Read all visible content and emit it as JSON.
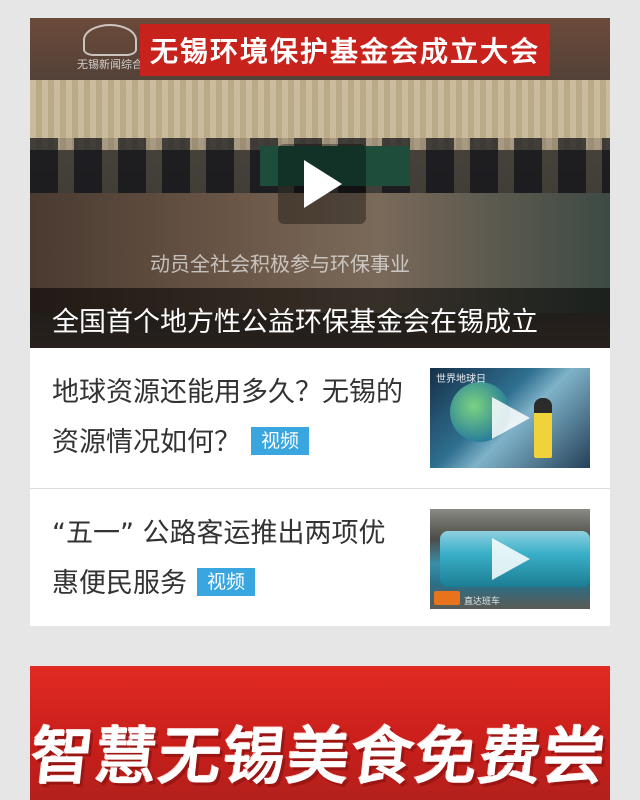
{
  "hero": {
    "banner_text": "无锡环境保护基金会成立大会",
    "logo_text": "无锡新闻综合",
    "subline": "动员全社会积极参与环保事业",
    "caption": "全国首个地方性公益环保基金会在锡成立"
  },
  "news": [
    {
      "title": "地球资源还能用多久？无锡的资源情况如何？",
      "tag": "视频",
      "thumb_label": "世界地球日"
    },
    {
      "title": "“五一” 公路客运推出两项优惠便民服务",
      "tag": "视频",
      "thumb_label": "直达班车"
    }
  ],
  "ad": {
    "text": "智慧无锡美食免费尝"
  },
  "icons": {
    "hero_play": "play-icon",
    "thumb_play": "play-icon"
  },
  "colors": {
    "tag_bg": "#3aa6e0",
    "ad_bg": "#e22a24",
    "banner_red": "#c8221c"
  }
}
